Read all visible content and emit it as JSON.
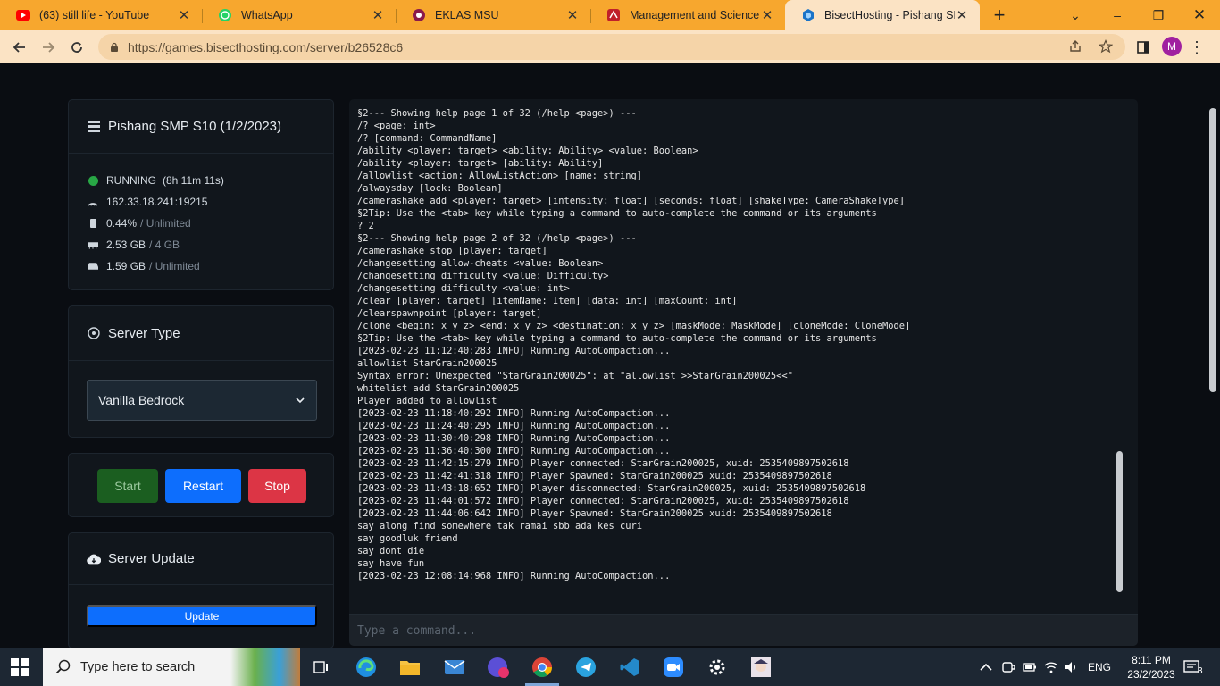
{
  "browser": {
    "tabs": [
      {
        "title": "(63) still life - YouTube",
        "icon": "youtube-icon"
      },
      {
        "title": "WhatsApp",
        "icon": "whatsapp-icon"
      },
      {
        "title": "EKLAS MSU",
        "icon": "eklas-icon"
      },
      {
        "title": "Management and Science U",
        "icon": "msu-icon"
      },
      {
        "title": "BisectHosting - Pishang SMP",
        "icon": "bisect-icon",
        "active": true
      }
    ],
    "url": "https://games.bisecthosting.com/server/b26528c6",
    "profile_initial": "M"
  },
  "server": {
    "name": "Pishang SMP S10 (1/2/2023)",
    "status": "RUNNING",
    "uptime": "(8h 11m 11s)",
    "address": "162.33.18.241:19215",
    "cpu": "0.44%",
    "cpu_limit": "/ Unlimited",
    "memory": "2.53 GB",
    "memory_limit": "/ 4 GB",
    "disk": "1.59 GB",
    "disk_limit": "/ Unlimited"
  },
  "server_type": {
    "heading": "Server Type",
    "selected": "Vanilla Bedrock"
  },
  "power": {
    "start": "Start",
    "restart": "Restart",
    "stop": "Stop"
  },
  "server_update": {
    "heading": "Server Update",
    "button": "Update"
  },
  "console": {
    "lines": [
      "§2--- Showing help page 1 of 32 (/help <page>) ---",
      "/? <page: int>",
      "/? [command: CommandName]",
      "/ability <player: target> <ability: Ability> <value: Boolean>",
      "/ability <player: target> [ability: Ability]",
      "/allowlist <action: AllowListAction> [name: string]",
      "/alwaysday [lock: Boolean]",
      "/camerashake add <player: target> [intensity: float] [seconds: float] [shakeType: CameraShakeType]",
      "§2Tip: Use the <tab> key while typing a command to auto-complete the command or its arguments",
      "? 2",
      "§2--- Showing help page 2 of 32 (/help <page>) ---",
      "/camerashake stop [player: target]",
      "/changesetting allow-cheats <value: Boolean>",
      "/changesetting difficulty <value: Difficulty>",
      "/changesetting difficulty <value: int>",
      "/clear [player: target] [itemName: Item] [data: int] [maxCount: int]",
      "/clearspawnpoint [player: target]",
      "/clone <begin: x y z> <end: x y z> <destination: x y z> [maskMode: MaskMode] [cloneMode: CloneMode]",
      "§2Tip: Use the <tab> key while typing a command to auto-complete the command or its arguments",
      "[2023-02-23 11:12:40:283 INFO] Running AutoCompaction...",
      "allowlist StarGrain200025",
      "Syntax error: Unexpected \"StarGrain200025\": at \"allowlist >>StarGrain200025<<\"",
      "whitelist add StarGrain200025",
      "Player added to allowlist",
      "[2023-02-23 11:18:40:292 INFO] Running AutoCompaction...",
      "[2023-02-23 11:24:40:295 INFO] Running AutoCompaction...",
      "[2023-02-23 11:30:40:298 INFO] Running AutoCompaction...",
      "[2023-02-23 11:36:40:300 INFO] Running AutoCompaction...",
      "[2023-02-23 11:42:15:279 INFO] Player connected: StarGrain200025, xuid: 2535409897502618",
      "[2023-02-23 11:42:41:318 INFO] Player Spawned: StarGrain200025 xuid: 2535409897502618",
      "[2023-02-23 11:43:18:652 INFO] Player disconnected: StarGrain200025, xuid: 2535409897502618",
      "[2023-02-23 11:44:01:572 INFO] Player connected: StarGrain200025, xuid: 2535409897502618",
      "[2023-02-23 11:44:06:642 INFO] Player Spawned: StarGrain200025 xuid: 2535409897502618",
      "say along find somewhere tak ramai sbb ada kes curi",
      "say goodluk friend",
      "say dont die",
      "say have fun",
      "[2023-02-23 12:08:14:968 INFO] Running AutoCompaction..."
    ],
    "placeholder": "Type a command..."
  },
  "taskbar": {
    "search_placeholder": "Type here to search",
    "language": "ENG",
    "time": "8:11 PM",
    "date": "23/2/2023",
    "notification_count": "3"
  },
  "colors": {
    "tab_strip": "#f7a72e",
    "running": "#28a745",
    "restart": "#0d6efd",
    "stop": "#dc3545",
    "start": "#1b5e20"
  }
}
